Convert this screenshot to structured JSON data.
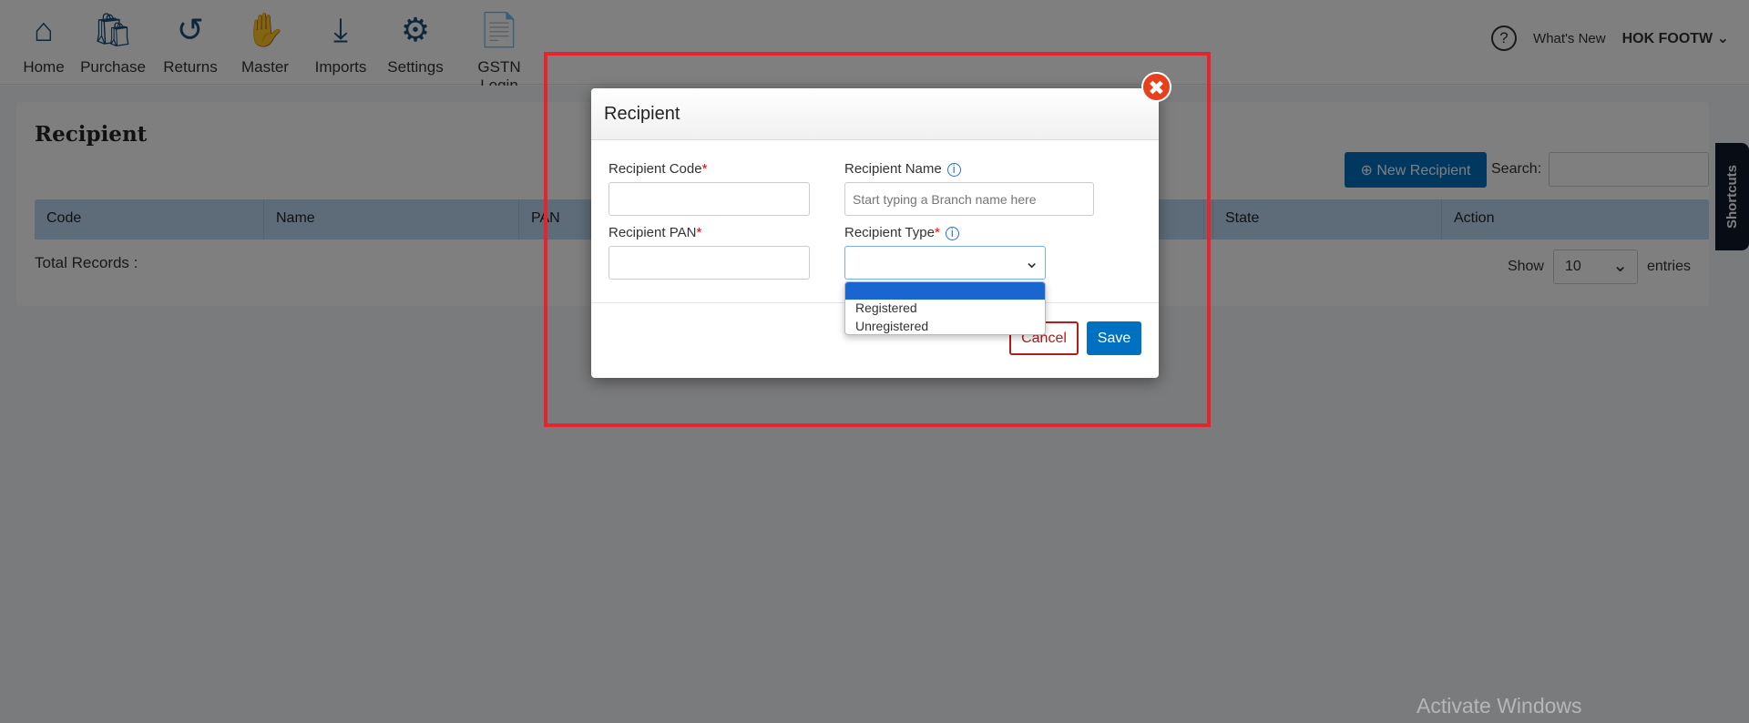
{
  "nav": {
    "items": [
      {
        "label": "Home",
        "icon": "home-icon",
        "glyph": "⌂"
      },
      {
        "label": "Purchase",
        "icon": "shopping-bag-icon",
        "glyph": "🛍"
      },
      {
        "label": "Returns",
        "icon": "returns-icon",
        "glyph": "↺"
      },
      {
        "label": "Master",
        "icon": "master-icon",
        "glyph": "✋"
      },
      {
        "label": "Imports",
        "icon": "import-download-icon",
        "glyph": "⤓"
      },
      {
        "label": "Settings",
        "icon": "settings-tools-icon",
        "glyph": "⚙"
      },
      {
        "label": "GSTN Login",
        "icon": "gst-document-icon",
        "glyph": "📄"
      }
    ],
    "help": "?",
    "whats_new": "What's New",
    "user": "HOK FOOTW"
  },
  "page": {
    "title": "Recipient",
    "new_button": "New Recipient",
    "search_label": "Search:",
    "search_value": "",
    "columns": [
      "Code",
      "Name",
      "PAN",
      "",
      "",
      "",
      "State",
      "Action"
    ],
    "total_records": "Total Records :",
    "show": "Show",
    "entries_value": "10",
    "entries": "entries",
    "shortcuts": "Shortcuts"
  },
  "dialog": {
    "title": "Recipient",
    "code_label": "Recipient Code",
    "name_label": "Recipient Name",
    "name_placeholder": "Start typing a Branch name here",
    "pan_label": "Recipient PAN",
    "type_label": "Recipient Type",
    "required": "*",
    "info": "i",
    "type_options": [
      "",
      "Registered",
      "Unregistered"
    ],
    "cancel": "Cancel",
    "save": "Save",
    "close": "✖"
  },
  "watermark": "Activate Windows",
  "colors": {
    "primary": "#0070c0",
    "danger": "#b11c1c",
    "close": "#e8401c",
    "highlight": "#e8232d"
  }
}
